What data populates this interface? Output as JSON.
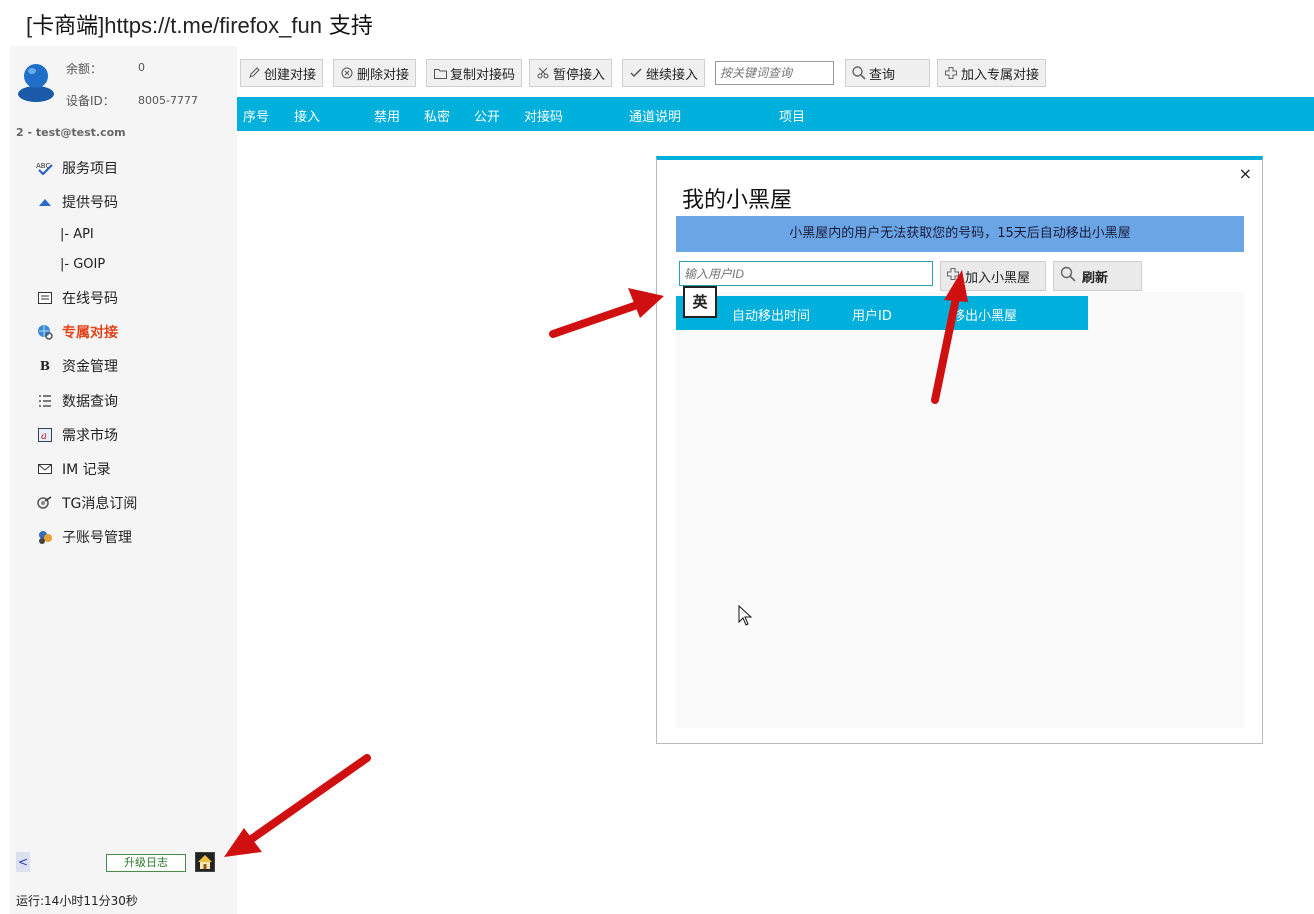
{
  "window": {
    "title_bracket_open": "[",
    "title_app": "卡商端",
    "title_bracket_close": "]",
    "title_url": "https://t.me/firefox_fun",
    "title_support": " 支持"
  },
  "account": {
    "balance_label": "余额：",
    "balance_value": "0",
    "device_label": "设备ID：",
    "device_value": "8005-7777",
    "user_line": "2 - test@test.com"
  },
  "sidebar": {
    "items": [
      {
        "label": "服务项目",
        "icon": "abc-check-icon"
      },
      {
        "label": "提供号码",
        "icon": "arrow-up-icon"
      },
      {
        "label": "在线号码",
        "icon": "list-box-icon"
      },
      {
        "label": "专属对接",
        "icon": "globe-link-icon",
        "active": true
      },
      {
        "label": "资金管理",
        "icon": "bold-b-icon"
      },
      {
        "label": "数据查询",
        "icon": "numbered-list-icon"
      },
      {
        "label": "需求市场",
        "icon": "market-icon"
      },
      {
        "label": "IM 记录",
        "icon": "mail-icon"
      },
      {
        "label": "TG消息订阅",
        "icon": "satellite-icon"
      },
      {
        "label": "子账号管理",
        "icon": "users-icon"
      }
    ],
    "subitems": [
      {
        "label": "|-  API"
      },
      {
        "label": "|-  GOIP"
      }
    ],
    "collapse_label": "<",
    "changelog_label": "升级日志",
    "runtime": "运行:14小时11分30秒"
  },
  "toolbar": {
    "create_label": "创建对接",
    "delete_label": "删除对接",
    "copy_label": "复制对接码",
    "pause_label": "暂停接入",
    "resume_label": "继续接入",
    "search_placeholder": "按关键词查询",
    "query_label": "查询",
    "add_exclusive_label": "加入专属对接"
  },
  "table": {
    "columns": [
      "序号",
      "接入",
      "禁用",
      "私密",
      "公开",
      "对接码",
      "通道说明",
      "项目"
    ]
  },
  "dialog": {
    "title": "我的小黑屋",
    "close_label": "×",
    "notice": "小黑屋内的用户无法获取您的号码，15天后自动移出小黑屋",
    "userid_placeholder": "输入用户ID",
    "add_label": "加入小黑屋",
    "refresh_label": "刷新",
    "columns": [
      "自动移出时间",
      "用户ID",
      "移出小黑屋"
    ],
    "ime_badge": "英"
  },
  "colors": {
    "accent": "#00b0dc",
    "notice_bg": "#6aa6e6",
    "active_nav": "#e2441a",
    "annotation_arrow": "#d01010"
  }
}
